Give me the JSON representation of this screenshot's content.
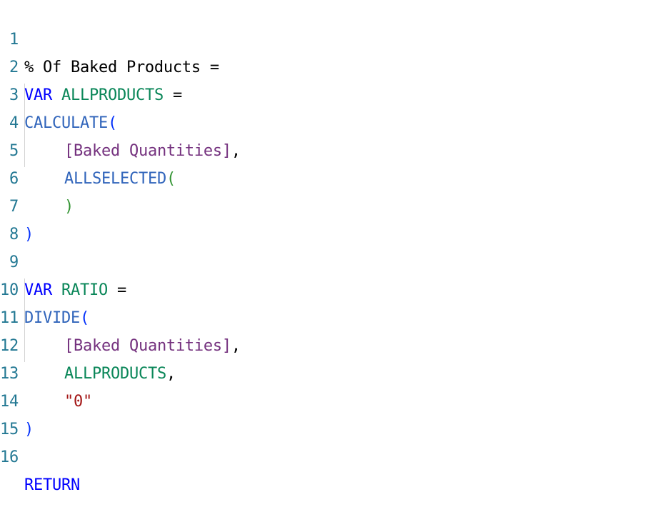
{
  "editor": {
    "lines": [
      {
        "num": "1",
        "tokens": [
          "% Of Baked Products ="
        ]
      },
      {
        "num": "2",
        "tokens": [
          "VAR",
          "ALLPRODUCTS",
          "="
        ]
      },
      {
        "num": "3",
        "tokens": [
          "CALCULATE",
          "("
        ]
      },
      {
        "num": "4",
        "tokens": [
          "[Baked Quantities]",
          ","
        ]
      },
      {
        "num": "5",
        "tokens": [
          "ALLSELECTED",
          "("
        ]
      },
      {
        "num": "6",
        "tokens": [
          ")"
        ]
      },
      {
        "num": "7",
        "tokens": [
          ")"
        ]
      },
      {
        "num": "8",
        "tokens": []
      },
      {
        "num": "9",
        "tokens": [
          "VAR",
          "RATIO",
          "="
        ]
      },
      {
        "num": "10",
        "tokens": [
          "DIVIDE",
          "("
        ]
      },
      {
        "num": "11",
        "tokens": [
          "[Baked Quantities]",
          ","
        ]
      },
      {
        "num": "12",
        "tokens": [
          "ALLPRODUCTS",
          ","
        ]
      },
      {
        "num": "13",
        "tokens": [
          "\"0\""
        ]
      },
      {
        "num": "14",
        "tokens": [
          ")"
        ]
      },
      {
        "num": "15",
        "tokens": []
      },
      {
        "num": "16",
        "tokens": [
          "RETURN"
        ]
      }
    ]
  },
  "colors": {
    "line_number": "#237893",
    "default": "#000000",
    "keyword": "#0000ff",
    "function": "#3165bb",
    "variable": "#098658",
    "column": "#74317e",
    "bracket_level1": "#0431fa",
    "bracket_level2": "#319331",
    "string": "#a31515",
    "indent_guide": "#d3d3d3",
    "background": "#ffffff"
  }
}
